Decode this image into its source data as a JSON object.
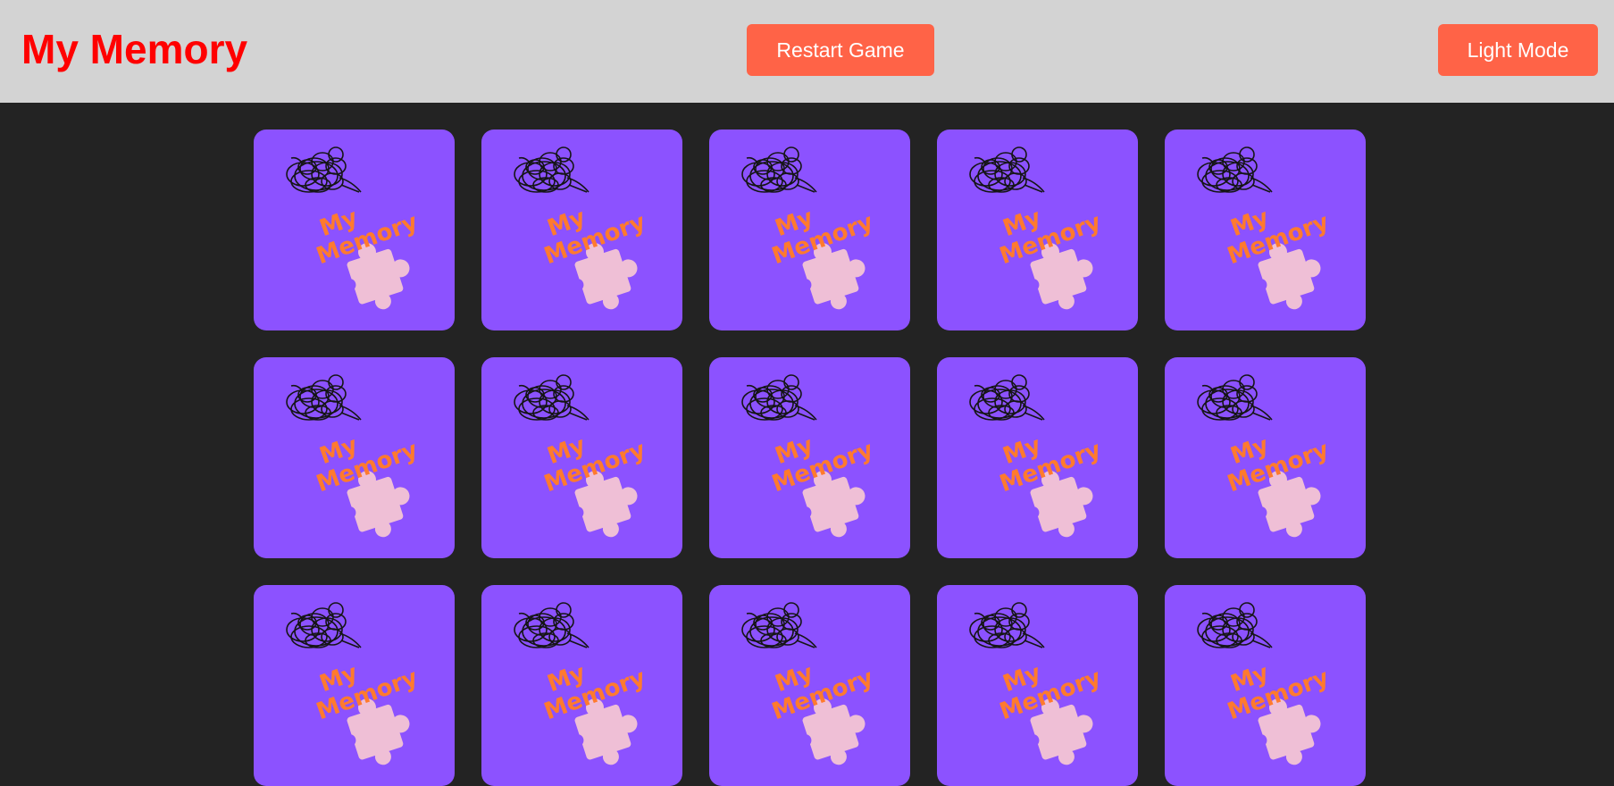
{
  "header": {
    "title": "My Memory",
    "restart_label": "Restart Game",
    "mode_label": "Light Mode"
  },
  "board": {
    "card_back_line1": "My",
    "card_back_line2": "Memory",
    "cards": [
      {
        "state": "face-down"
      },
      {
        "state": "face-down"
      },
      {
        "state": "face-down"
      },
      {
        "state": "face-down"
      },
      {
        "state": "face-down"
      },
      {
        "state": "face-down"
      },
      {
        "state": "face-down"
      },
      {
        "state": "face-down"
      },
      {
        "state": "face-down"
      },
      {
        "state": "face-down"
      },
      {
        "state": "face-down"
      },
      {
        "state": "face-down"
      },
      {
        "state": "face-down"
      },
      {
        "state": "face-down"
      },
      {
        "state": "face-down"
      }
    ]
  },
  "colors": {
    "header_bg": "#d3d3d3",
    "page_bg": "#232323",
    "title": "#ff0000",
    "button": "#ff6347",
    "card": "#8c52ff",
    "logo_text": "#ff7a2e",
    "puzzle": "#efbfd6"
  }
}
